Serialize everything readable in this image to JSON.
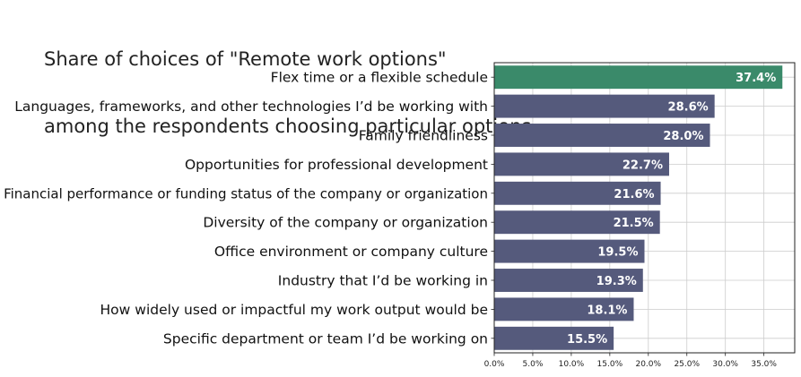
{
  "title_lines": [
    "Share of choices of \"Remote work options\"",
    "among the respondents choosing particular options"
  ],
  "chart_data": {
    "type": "bar",
    "orientation": "horizontal",
    "title": "Share of choices of \"Remote work options\" among the respondents choosing particular options",
    "xlabel": "",
    "ylabel": "",
    "xlim": [
      0,
      39
    ],
    "x_ticks": [
      0,
      5,
      10,
      15,
      20,
      25,
      30,
      35
    ],
    "x_tick_labels": [
      "0.0%",
      "5.0%",
      "10.0%",
      "15.0%",
      "20.0%",
      "25.0%",
      "30.0%",
      "35.0%"
    ],
    "grid": true,
    "colors": {
      "highlight": "#3a8a6a",
      "default": "#555a7c",
      "grid": "#cccccc"
    },
    "categories": [
      "Flex time or a flexible schedule",
      "Languages, frameworks, and other technologies I’d be working with",
      "Family friendliness",
      "Opportunities for professional development",
      "Financial performance or funding status of the company or organization",
      "Diversity of the company or organization",
      "Office environment or company culture",
      "Industry that I’d be working in",
      "How widely used or impactful my work output would be",
      "Specific department or team I’d be working on"
    ],
    "values": [
      37.4,
      28.6,
      28.0,
      22.7,
      21.6,
      21.5,
      19.5,
      19.3,
      18.1,
      15.5
    ],
    "value_labels": [
      "37.4%",
      "28.6%",
      "28.0%",
      "22.7%",
      "21.6%",
      "21.5%",
      "19.5%",
      "19.3%",
      "18.1%",
      "15.5%"
    ],
    "highlight_index": 0
  }
}
